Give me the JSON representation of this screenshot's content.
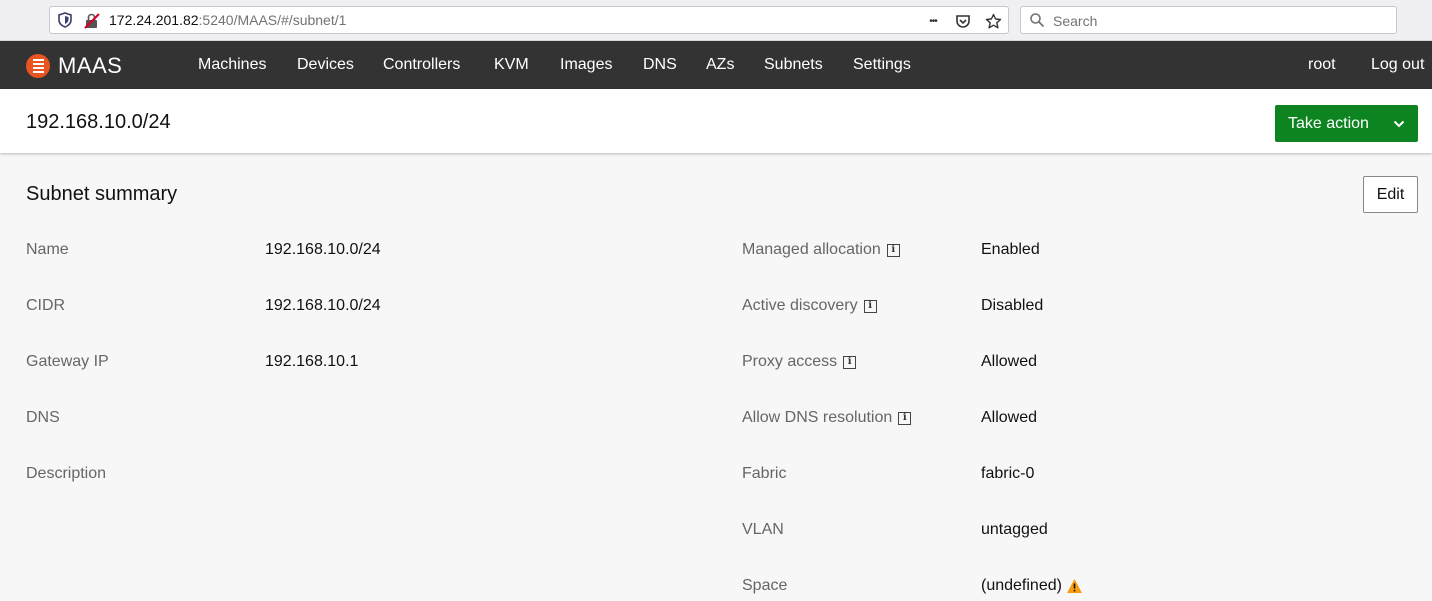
{
  "browser": {
    "url_host": "172.24.201.82",
    "url_rest": ":5240/MAAS/#/subnet/1",
    "search_placeholder": "Search",
    "more_icon": "•••"
  },
  "nav": {
    "brand": "MAAS",
    "links": [
      "Machines",
      "Devices",
      "Controllers",
      "KVM",
      "Images",
      "DNS",
      "AZs",
      "Subnets",
      "Settings"
    ],
    "user": "root",
    "logout": "Log out"
  },
  "header": {
    "title": "192.168.10.0/24",
    "take_action": "Take action"
  },
  "summary": {
    "title": "Subnet summary",
    "edit": "Edit",
    "left": [
      {
        "label": "Name",
        "value": "192.168.10.0/24"
      },
      {
        "label": "CIDR",
        "value": "192.168.10.0/24"
      },
      {
        "label": "Gateway IP",
        "value": "192.168.10.1"
      },
      {
        "label": "DNS",
        "value": ""
      },
      {
        "label": "Description",
        "value": ""
      }
    ],
    "right": [
      {
        "label": "Managed allocation",
        "value": "Enabled"
      },
      {
        "label": "Active discovery",
        "value": "Disabled"
      },
      {
        "label": "Proxy access",
        "value": "Allowed"
      },
      {
        "label": "Allow DNS resolution",
        "value": "Allowed"
      },
      {
        "label": "Fabric",
        "value": "fabric-0"
      },
      {
        "label": "VLAN",
        "value": "untagged"
      },
      {
        "label": "Space",
        "value": "(undefined)"
      }
    ]
  },
  "colors": {
    "nav_bg": "#333333",
    "brand_orange": "#e95420",
    "action_green": "#0e8420",
    "warning": "#f99b11"
  }
}
